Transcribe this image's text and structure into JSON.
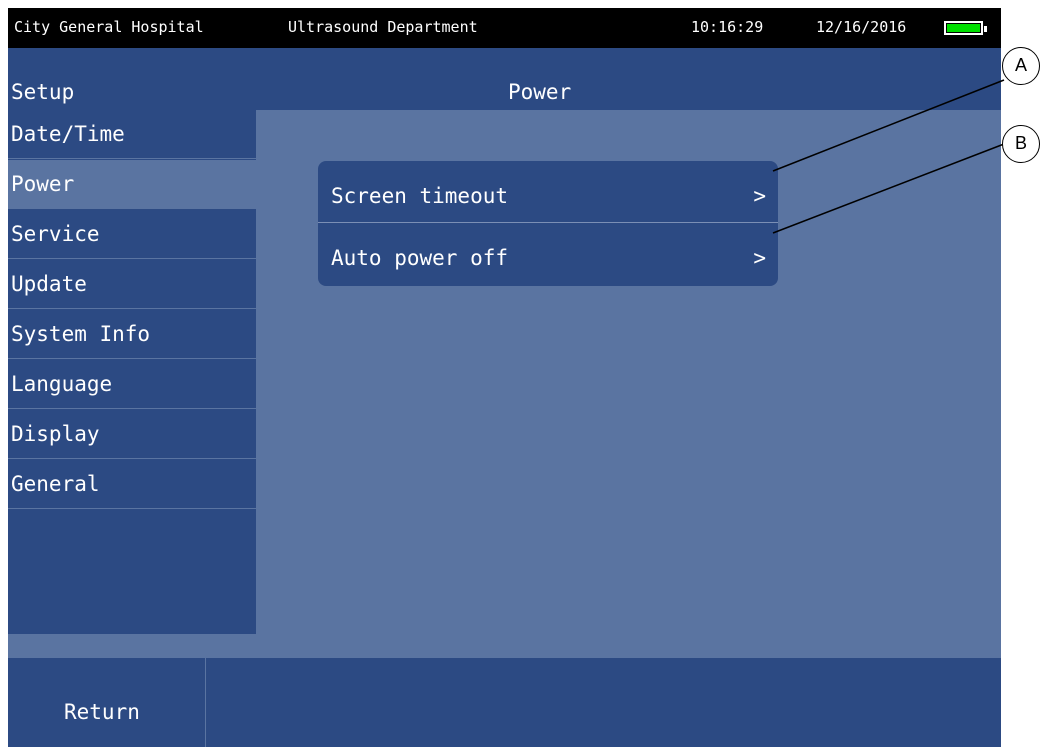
{
  "status": {
    "hospital": "City General Hospital",
    "department": "Ultrasound Department",
    "time": "10:16:29",
    "date": "12/16/2016",
    "battery_icon": "battery-full-icon",
    "battery_color": "#00e000"
  },
  "header": {
    "left": "Setup",
    "title": "Power"
  },
  "sidebar": {
    "items": [
      {
        "label": "Date/Time"
      },
      {
        "label": "Power",
        "active": true
      },
      {
        "label": "Service"
      },
      {
        "label": "Update"
      },
      {
        "label": "System Info"
      },
      {
        "label": "Language"
      },
      {
        "label": "Display"
      },
      {
        "label": "General"
      }
    ]
  },
  "menu": {
    "items": [
      {
        "label": "Screen timeout",
        "chevron": ">"
      },
      {
        "label": "Auto power off",
        "chevron": ">"
      }
    ]
  },
  "footer": {
    "return_label": "Return"
  },
  "callouts": {
    "a": "A",
    "b": "B"
  },
  "colors": {
    "primary": "#2c4a83",
    "panel": "#5a74a1",
    "status_bg": "#000000"
  }
}
